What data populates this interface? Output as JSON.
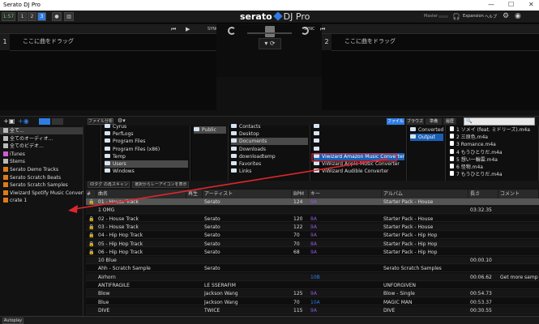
{
  "window": {
    "title": "Serato DJ Pro",
    "minimize": "—",
    "maximize": "☐",
    "close": "✕"
  },
  "topbar": {
    "time": "1:57",
    "deck_btn_1": "1",
    "deck_btn_2": "2",
    "deck_btn_3": "3",
    "master_label": "Master",
    "expansion_label": "Expansion",
    "help_label": "ヘルプ",
    "logo_brand": "serato",
    "logo_product": "DJ Pro"
  },
  "deck_left": {
    "number": "1",
    "placeholder": "ここに曲をドラッグ",
    "sync": "SYNC"
  },
  "deck_right": {
    "number": "2",
    "placeholder": "ここに曲をドラッグ",
    "sync": "SYNC"
  },
  "library_bar": {
    "file_btn": "ファイル分析",
    "tab_file": "ファイル",
    "tab_browse": "ブラウズ",
    "tab_prepare": "準備",
    "tab_history": "履歴",
    "search_placeholder": ""
  },
  "crates": [
    {
      "label": "全て...",
      "color": "#bbbbbb",
      "icon": "all-icon"
    },
    {
      "label": "全てのオーディオ...",
      "color": "#bbbbbb",
      "icon": "speaker-icon"
    },
    {
      "label": "全てのビデオ...",
      "color": "#bbbbbb",
      "icon": "video-icon"
    },
    {
      "label": "iTunes",
      "color": "#d15bd6",
      "icon": "itunes-icon"
    },
    {
      "label": "Stems",
      "color": "#bbbbbb",
      "icon": "stems-icon"
    },
    {
      "label": "Serato Demo Tracks",
      "color": "#e07b1b",
      "icon": "crate-icon"
    },
    {
      "label": "Serato Scratch Beats",
      "color": "#e07b1b",
      "icon": "crate-icon"
    },
    {
      "label": "Serato Scratch Samples",
      "color": "#e07b1b",
      "icon": "crate-icon"
    },
    {
      "label": "Viwizard Spotify Music Converter",
      "color": "#e07b1b",
      "icon": "crate-icon"
    },
    {
      "label": "crate 1",
      "color": "#e07b1b",
      "icon": "crate-icon"
    }
  ],
  "browser": {
    "col1": [
      "Cyrus",
      "PerfLogs",
      "Program Files",
      "Program Files (x86)",
      "Temp",
      "Users",
      "Windows"
    ],
    "col2": [
      "Public"
    ],
    "col3": [
      "Contacts",
      "Desktop",
      "Documents",
      "Downloads",
      "downloadtemp",
      "Favorites",
      "Links"
    ],
    "col4": [
      "",
      "",
      "",
      "",
      "Viwizard Amazon Music Converter",
      "ViWizard Apple Music Converter",
      "ViWizard Audible Converter"
    ],
    "col5": [
      "Converted",
      "Output"
    ],
    "col6": [
      "1 ソメイ (feat. ミドリーズ).m4a",
      "2 三原色.m4a",
      "3 Romance.m4a",
      "4 もうひとりだ.m4a",
      "5 想い一輪雲.m4a",
      "6 怪物.m4a",
      "7 もうひとりだ.m4a"
    ]
  },
  "filters": {
    "f1": "iDタグ の再スキャン",
    "f2": "選択からレーアイコンを表示"
  },
  "columns": [
    "#",
    "曲名",
    "再生",
    "アーティスト",
    "BPM",
    "キー",
    "アルバム",
    "長さ",
    "コメント"
  ],
  "rows": [
    {
      "title": "01 - House Track",
      "artist": "Serato",
      "bpm": "124",
      "key": "9A",
      "album": "Starter Pack - House",
      "len": "",
      "comment": "",
      "sel": true
    },
    {
      "title": "1 OMG",
      "artist": "",
      "bpm": "",
      "key": "",
      "album": "",
      "len": "03:32.35",
      "comment": ""
    },
    {
      "title": "02 - House Track",
      "artist": "Serato",
      "bpm": "120",
      "key": "8A",
      "album": "Starter Pack - House",
      "len": "",
      "comment": ""
    },
    {
      "title": "03 - House Track",
      "artist": "Serato",
      "bpm": "122",
      "key": "9A",
      "album": "Starter Pack - House",
      "len": "",
      "comment": ""
    },
    {
      "title": "04 - Hip Hop Track",
      "artist": "Serato",
      "bpm": "70",
      "key": "9A",
      "album": "Starter Pack - Hip Hop",
      "len": "",
      "comment": ""
    },
    {
      "title": "05 - Hip Hop Track",
      "artist": "Serato",
      "bpm": "70",
      "key": "8A",
      "album": "Starter Pack - Hip Hop",
      "len": "",
      "comment": ""
    },
    {
      "title": "06 - Hip Hop Track",
      "artist": "Serato",
      "bpm": "68",
      "key": "9A",
      "album": "Starter Pack - Hip Hop",
      "len": "",
      "comment": ""
    },
    {
      "title": "10 Blue",
      "artist": "",
      "bpm": "",
      "key": "",
      "album": "",
      "len": "00:00.10",
      "comment": ""
    },
    {
      "title": "Ahh - Scratch Sample",
      "artist": "Serato",
      "bpm": "",
      "key": "",
      "album": "Serato Scratch Samples",
      "len": "",
      "comment": ""
    },
    {
      "title": "Airhorn",
      "artist": "",
      "bpm": "",
      "key": "10B",
      "album": "",
      "len": "00:06.62",
      "comment": "Get more sample"
    },
    {
      "title": "ANTIFRAGILE",
      "artist": "LE SSERAFIM",
      "bpm": "",
      "key": "",
      "album": "UNFORGIVEN",
      "len": "",
      "comment": ""
    },
    {
      "title": "Blow",
      "artist": "Jackson Wang",
      "bpm": "125",
      "key": "9A",
      "album": "Blow - Single",
      "len": "00:54.73",
      "comment": ""
    },
    {
      "title": "Blue",
      "artist": "Jackson Wang",
      "bpm": "70",
      "key": "10A",
      "album": "MAGIC MAN",
      "len": "00:53.37",
      "comment": ""
    },
    {
      "title": "DIVE",
      "artist": "TWICE",
      "bpm": "115",
      "key": "9A",
      "album": "DIVE",
      "len": "00:30.55",
      "comment": ""
    }
  ],
  "status": {
    "autoplay": "Autoplay"
  },
  "colors": {
    "accent": "#2f7de1",
    "arrow": "#e0262e",
    "key_purple": "#8c5ad8",
    "key_blue": "#2f7de1"
  }
}
